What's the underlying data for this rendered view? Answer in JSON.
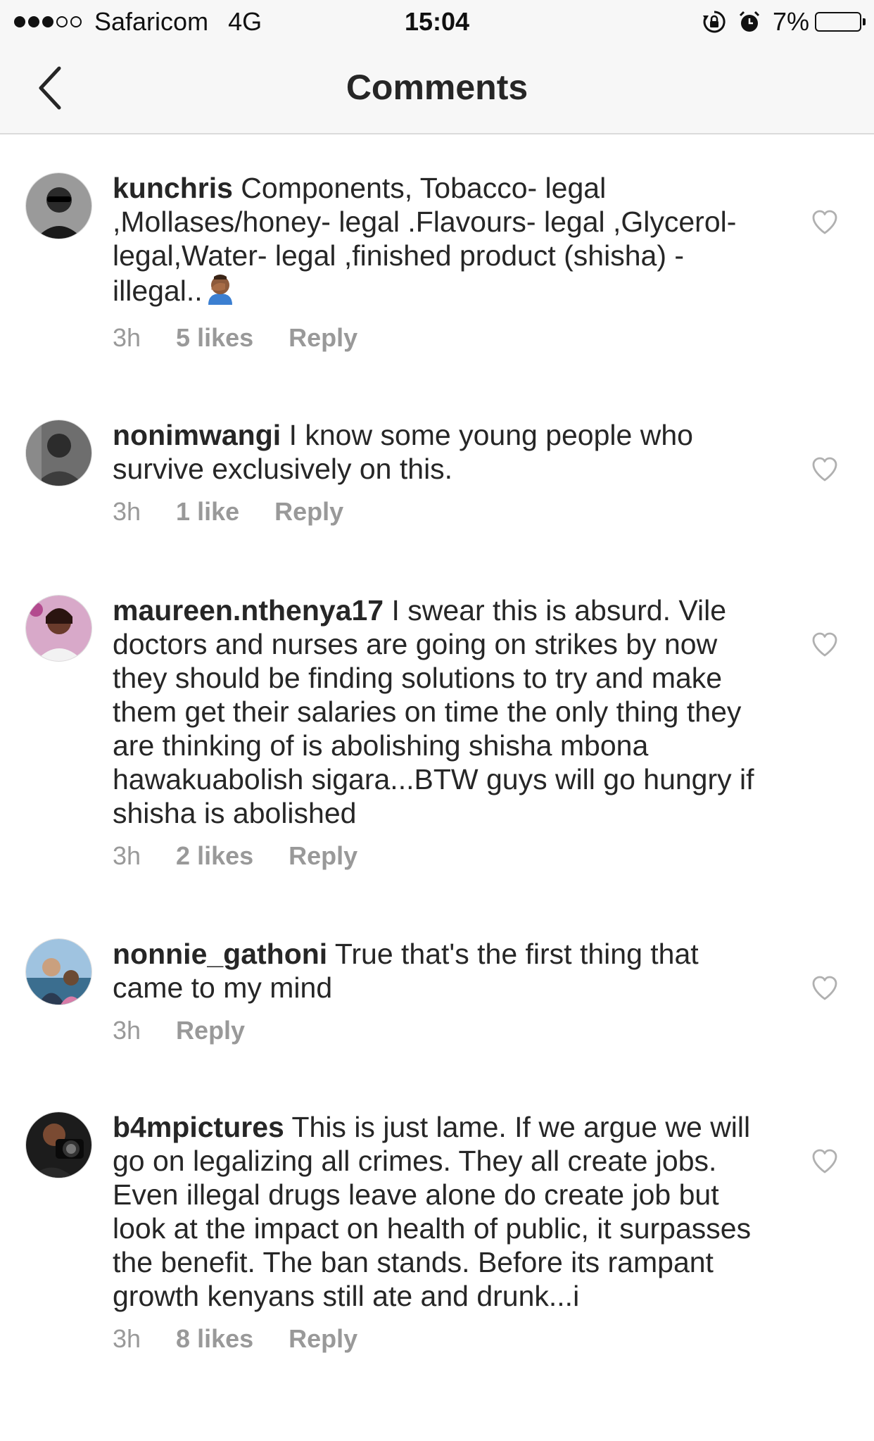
{
  "status_bar": {
    "carrier": "Safaricom",
    "network": "4G",
    "time": "15:04",
    "battery": "7%",
    "battery_level": 0.07,
    "battery_color": "#f5c400"
  },
  "header": {
    "title": "Comments",
    "back_icon": "chevron-left-icon"
  },
  "comments": [
    {
      "username": "kunchris",
      "text": "Components, Tobacco- legal ,Mollases/honey- legal .Flavours- legal ,Glycerol- legal,Water- legal ,finished product (shisha) -illegal..",
      "emoji": "man-facepalming",
      "time": "3h",
      "likes": "5 likes",
      "reply": "Reply"
    },
    {
      "username": "nonimwangi",
      "text": "I know some young people who survive exclusively on this.",
      "time": "3h",
      "likes": "1 like",
      "reply": "Reply"
    },
    {
      "username": "maureen.nthenya17",
      "text": "I swear this is absurd. Vile doctors and nurses are going on strikes by now they should be finding solutions to try and make them get their salaries on time the only thing they are thinking of is abolishing shisha mbona hawakuabolish sigara...BTW guys will go hungry if shisha is abolished",
      "time": "3h",
      "likes": "2 likes",
      "reply": "Reply"
    },
    {
      "username": "nonnie_gathoni",
      "text": "True that's the first thing that came to my mind",
      "time": "3h",
      "likes": "",
      "reply": "Reply"
    },
    {
      "username": "b4mpictures",
      "text": "This is just lame. If we argue we will go on legalizing all crimes. They all create jobs. Even illegal drugs leave alone do create job but look at the impact on health of public, it surpasses the benefit. The ban stands. Before its rampant growth kenyans still ate and drunk...i",
      "time": "3h",
      "likes": "8 likes",
      "reply": "Reply"
    }
  ]
}
